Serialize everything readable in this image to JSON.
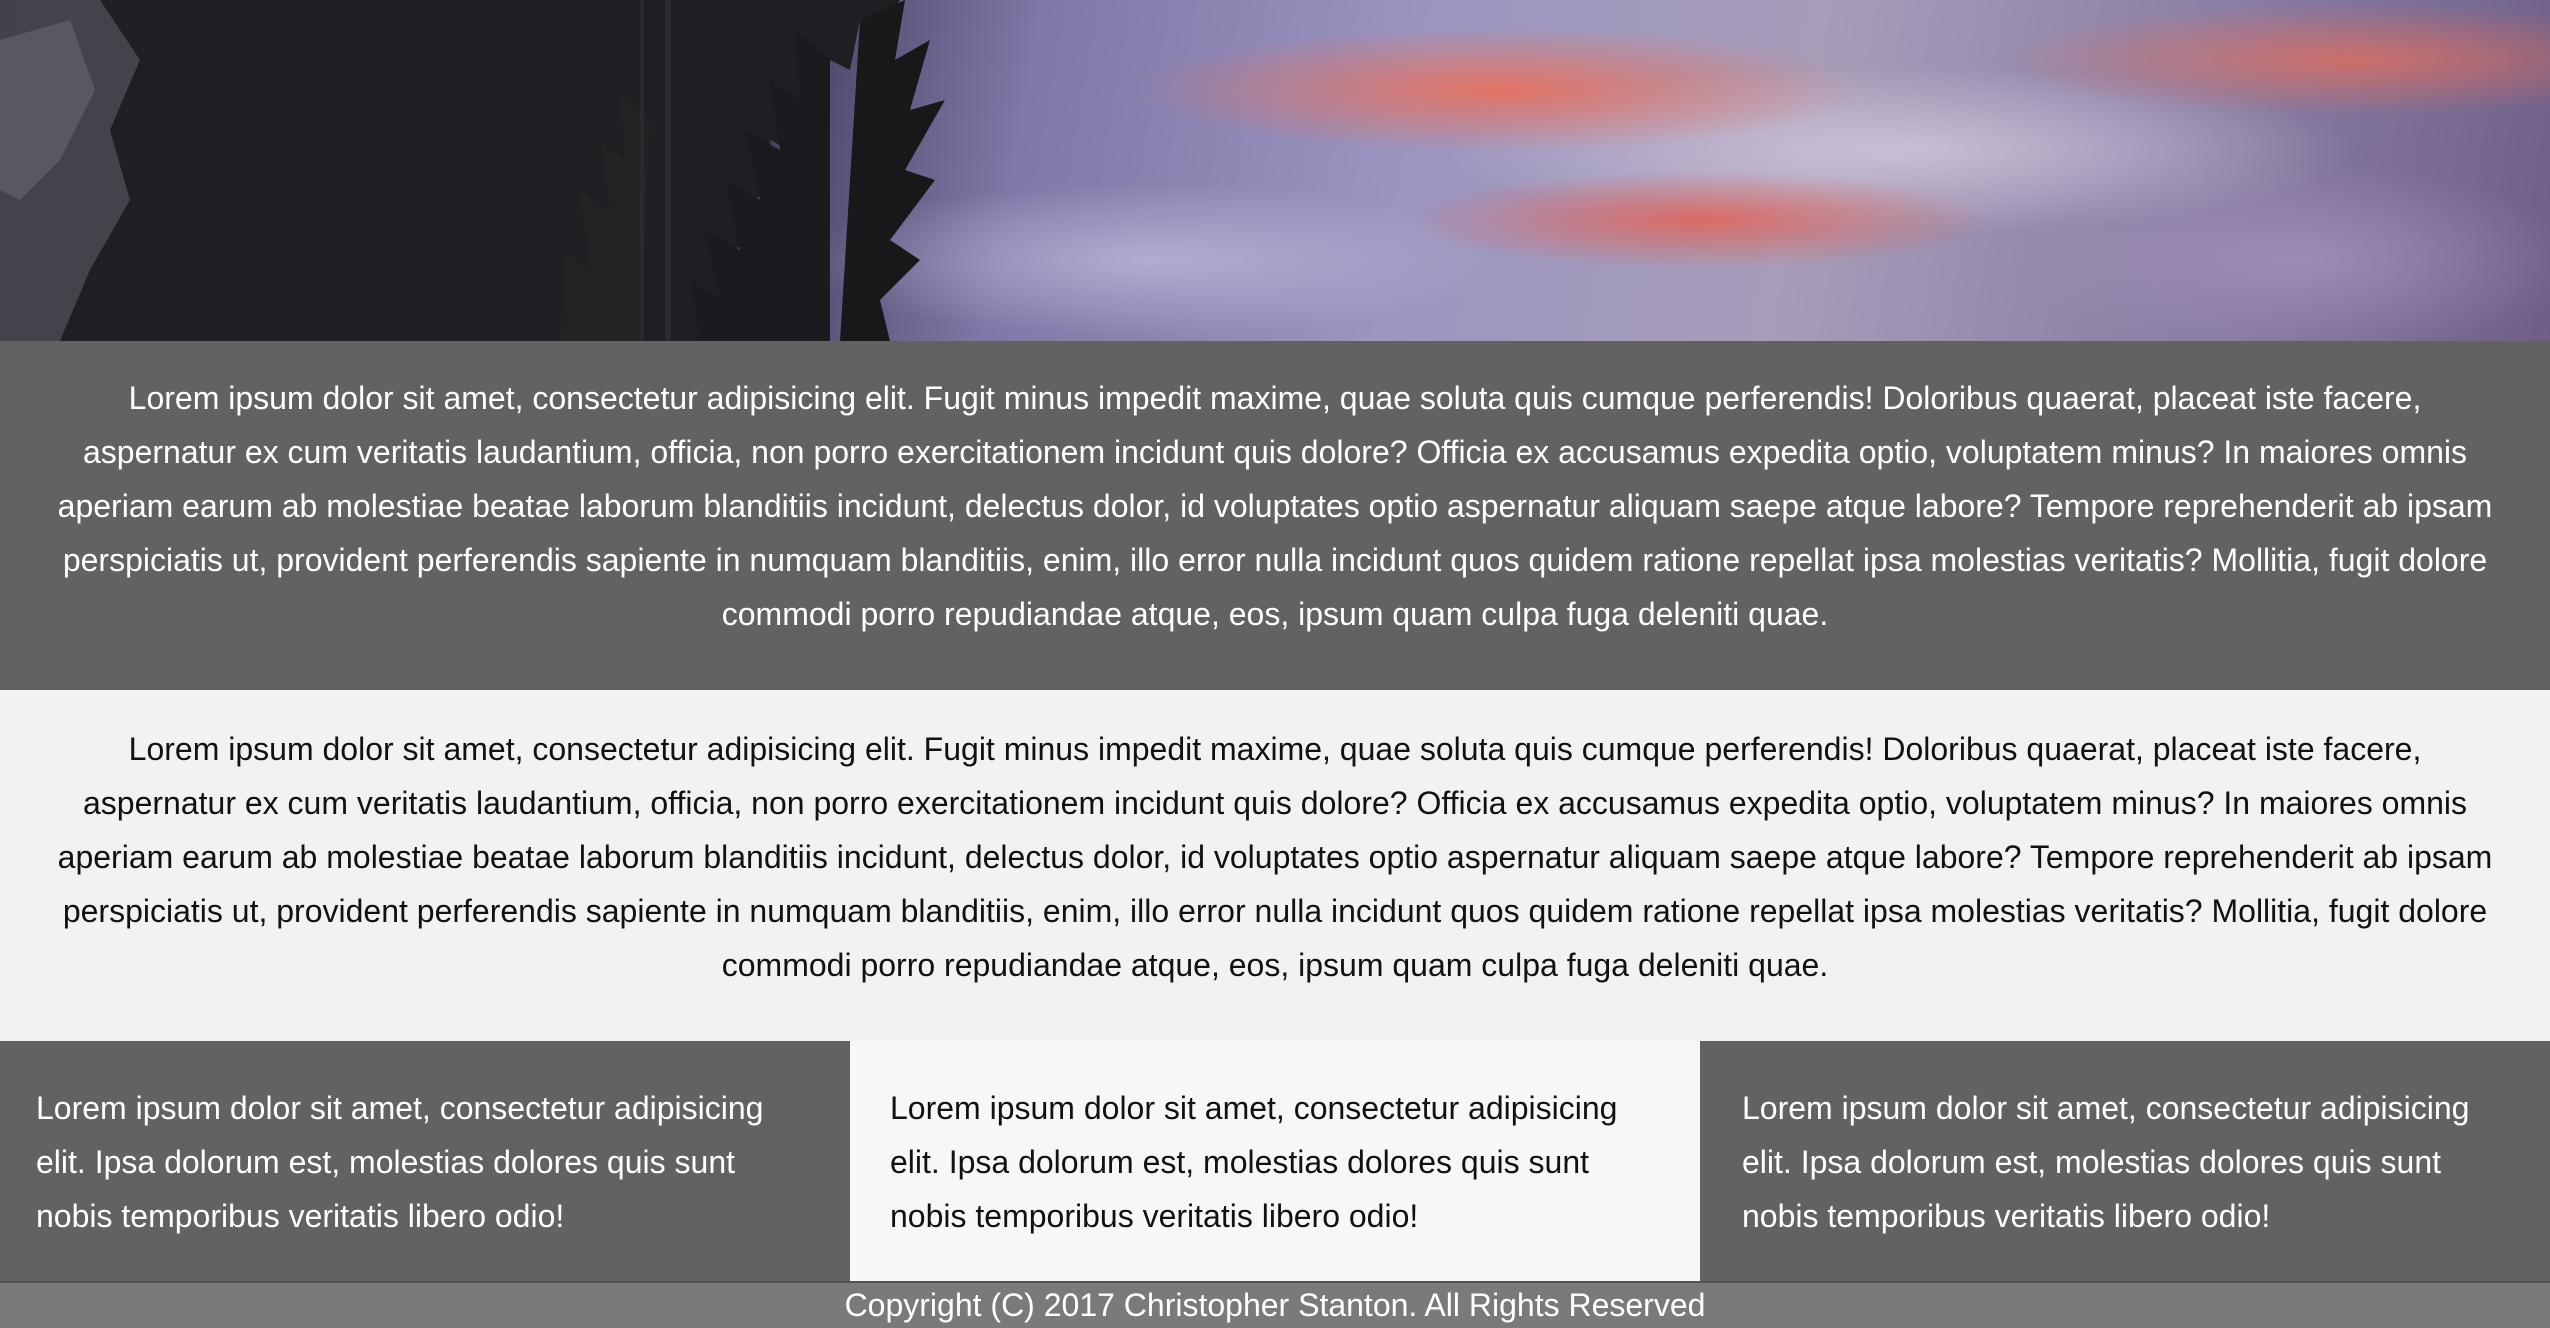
{
  "hero": {
    "image": "sunset-clouds-over-forest-photo"
  },
  "intro_band_dark": {
    "text": "Lorem ipsum dolor sit amet, consectetur adipisicing elit. Fugit minus impedit maxime, quae soluta quis cumque perferendis! Doloribus quaerat, placeat iste facere, aspernatur ex cum veritatis laudantium, officia, non porro exercitationem incidunt quis dolore? Officia ex accusamus expedita optio, voluptatem minus? In maiores omnis aperiam earum ab molestiae beatae laborum blanditiis incidunt, delectus dolor, id voluptates optio aspernatur aliquam saepe atque labore? Tempore reprehenderit ab ipsam perspiciatis ut, provident perferendis sapiente in numquam blanditiis, enim, illo error nulla incidunt quos quidem ratione repellat ipsa molestias veritatis? Mollitia, fugit dolore commodi porro repudiandae atque, eos, ipsum quam culpa fuga deleniti quae."
  },
  "intro_band_light": {
    "text": "Lorem ipsum dolor sit amet, consectetur adipisicing elit. Fugit minus impedit maxime, quae soluta quis cumque perferendis! Doloribus quaerat, placeat iste facere, aspernatur ex cum veritatis laudantium, officia, non porro exercitationem incidunt quis dolore? Officia ex accusamus expedita optio, voluptatem minus? In maiores omnis aperiam earum ab molestiae beatae laborum blanditiis incidunt, delectus dolor, id voluptates optio aspernatur aliquam saepe atque labore? Tempore reprehenderit ab ipsam perspiciatis ut, provident perferendis sapiente in numquam blanditiis, enim, illo error nulla incidunt quos quidem ratione repellat ipsa molestias veritatis? Mollitia, fugit dolore commodi porro repudiandae atque, eos, ipsum quam culpa fuga deleniti quae."
  },
  "columns": [
    {
      "text": "Lorem ipsum dolor sit amet, consectetur adipisicing elit. Ipsa dolorum est, molestias dolores quis sunt nobis temporibus veritatis libero odio!"
    },
    {
      "text": "Lorem ipsum dolor sit amet, consectetur adipisicing elit. Ipsa dolorum est, molestias dolores quis sunt nobis temporibus veritatis libero odio!"
    },
    {
      "text": "Lorem ipsum dolor sit amet, consectetur adipisicing elit. Ipsa dolorum est, molestias dolores quis sunt nobis temporibus veritatis libero odio!"
    }
  ],
  "footer": {
    "copyright": "Copyright (C) 2017 Christopher Stanton. All Rights Reserved"
  },
  "colors": {
    "dark_band": "#626262",
    "light_band": "#f2f2f2",
    "light_column": "#f7f7f7",
    "footer": "#7a7a7a"
  }
}
